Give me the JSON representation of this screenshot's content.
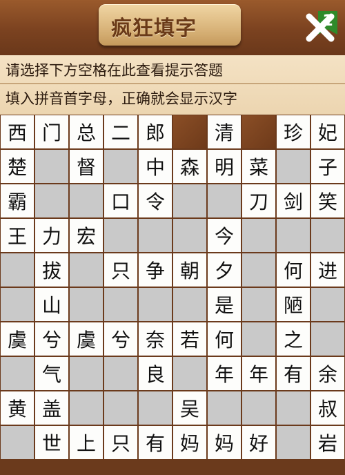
{
  "header": {
    "title": "疯狂填字",
    "level": "1",
    "close_icon": "close-icon"
  },
  "hints": {
    "line1": "请选择下方空格在此查看提示答题",
    "line2": "填入拼音首字母，正确就会显示汉字"
  },
  "colors": {
    "wood": "#6b3a1c",
    "filled_cell": "#fdfdfb",
    "blank_cell": "#c9c9c9",
    "level_flag": "#2f8a2a"
  },
  "grid": [
    [
      "西",
      "门",
      "总",
      "二",
      "郎",
      "#",
      "清",
      "#",
      "珍",
      "妃"
    ],
    [
      "楚",
      "_",
      "督",
      "_",
      "中",
      "森",
      "明",
      "菜",
      "_",
      "子"
    ],
    [
      "霸",
      "_",
      "_",
      "口",
      "令",
      "_",
      "_",
      "刀",
      "剑",
      "笑"
    ],
    [
      "王",
      "力",
      "宏",
      "_",
      "_",
      "_",
      "今",
      "_",
      "_",
      "_"
    ],
    [
      "_",
      "拔",
      "_",
      "只",
      "争",
      "朝",
      "夕",
      "_",
      "何",
      "进"
    ],
    [
      "_",
      "山",
      "_",
      "_",
      "_",
      "_",
      "是",
      "_",
      "陋",
      "_"
    ],
    [
      "虞",
      "兮",
      "虞",
      "兮",
      "奈",
      "若",
      "何",
      "_",
      "之",
      "_"
    ],
    [
      "_",
      "气",
      "_",
      "_",
      "良",
      "_",
      "年",
      "年",
      "有",
      "余"
    ],
    [
      "黄",
      "盖",
      "_",
      "_",
      "_",
      "吴",
      "_",
      "_",
      "_",
      "叔"
    ],
    [
      "_",
      "世",
      "上",
      "只",
      "有",
      "妈",
      "妈",
      "好",
      "_",
      "岩"
    ]
  ]
}
